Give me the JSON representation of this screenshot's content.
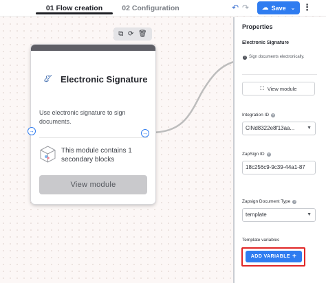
{
  "header": {
    "tabs": [
      {
        "label": "01 Flow creation",
        "active": true
      },
      {
        "label": "02 Configuration",
        "active": false
      }
    ],
    "undo_icon": "undo-icon",
    "redo_icon": "redo-icon",
    "save_label": "Save",
    "more_icon": "kebab-menu-icon"
  },
  "node_toolbar": {
    "icons": [
      "copy-icon",
      "refresh-icon",
      "trash-icon"
    ]
  },
  "module_card": {
    "title": "Electronic Signature",
    "icon": "signature-icon",
    "description": "Use electronic signature to sign documents.",
    "secondary_text": "This module contains 1 secondary blocks",
    "view_button": "View module"
  },
  "properties": {
    "title": "Properties",
    "module_name": "Electronic Signature",
    "info_text": "Sign documents electronically.",
    "view_button": "View module",
    "fields": [
      {
        "label": "Integration ID",
        "value": "ClNd8322e8f13aa...",
        "type": "select"
      },
      {
        "label": "ZapSign ID",
        "value": "18c256c9-9c39-44a1-87",
        "type": "text"
      },
      {
        "label": "Zapsign Document Type",
        "value": "template",
        "type": "select"
      }
    ],
    "template_variables_label": "Template variables",
    "add_variable_button": "ADD VARIABLE"
  },
  "colors": {
    "accent": "#2f7cf0",
    "highlight_outline": "#e02525"
  }
}
